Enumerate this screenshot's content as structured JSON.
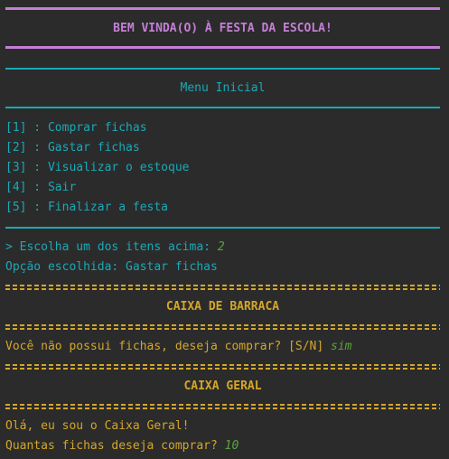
{
  "colors": {
    "background": "#2b2b2b",
    "purple": "#c57fd6",
    "teal": "#1aa9b7",
    "gold": "#d4a62a",
    "green_input": "#5aa33c"
  },
  "banner": {
    "title": "BEM VINDA(O) À FESTA DA ESCOLA!"
  },
  "menu": {
    "title": "Menu Inicial",
    "items": [
      "[1] : Comprar fichas",
      "[2] : Gastar fichas",
      "[3] : Visualizar o estoque",
      "[4] : Sair",
      "[5] : Finalizar a festa"
    ],
    "prompt": "> Escolha um dos itens acima: ",
    "prompt_answer": "2",
    "chosen": "Opção escolhida: Gastar fichas"
  },
  "caixa_barraca": {
    "title": "CAIXA DE BARRACA",
    "question": "Você não possui fichas, deseja comprar? [S/N] ",
    "answer": "sim"
  },
  "caixa_geral": {
    "title": "CAIXA GERAL",
    "greeting": "Olá, eu sou o Caixa Geral!",
    "question": "Quantas fichas deseja comprar? ",
    "answer": "10"
  }
}
